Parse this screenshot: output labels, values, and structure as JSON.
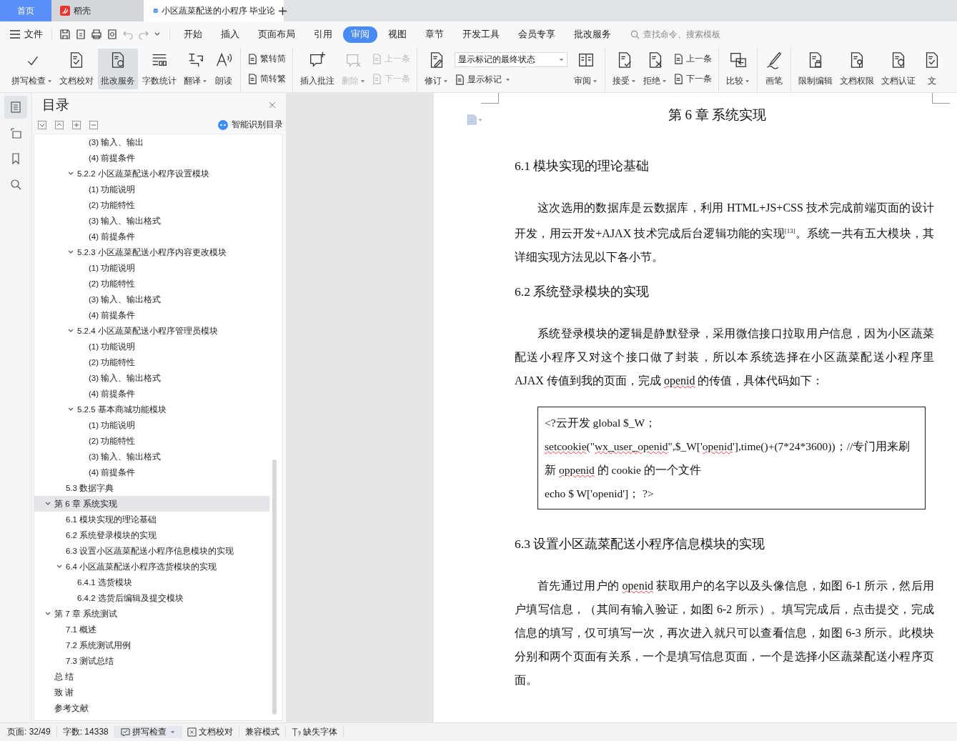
{
  "title_tabs": [
    {
      "label": "首页",
      "kind": "home",
      "selected": false
    },
    {
      "label": "稻壳",
      "kind": "store",
      "selected": false
    },
    {
      "label": "小区蔬菜配送的小程序 毕业论",
      "kind": "document",
      "selected": true
    }
  ],
  "menu": {
    "file": "文件",
    "tabs": [
      {
        "label": "开始",
        "selected": false
      },
      {
        "label": "插入",
        "selected": false
      },
      {
        "label": "页面布局",
        "selected": false
      },
      {
        "label": "引用",
        "selected": false
      },
      {
        "label": "审阅",
        "selected": true
      },
      {
        "label": "视图",
        "selected": false
      },
      {
        "label": "章节",
        "selected": false
      },
      {
        "label": "开发工具",
        "selected": false
      },
      {
        "label": "会员专享",
        "selected": false
      },
      {
        "label": "批改服务",
        "selected": false
      }
    ],
    "search": {
      "placeholder": "查找命令、搜索模板"
    }
  },
  "ribbon": [
    {
      "items": [
        {
          "kind": "big",
          "label": "拼写检查",
          "caret": true,
          "disabled": false,
          "pressed": false
        },
        {
          "kind": "big",
          "label": "文档校对",
          "caret": false,
          "disabled": false,
          "pressed": false
        },
        {
          "kind": "big",
          "label": "批改服务",
          "caret": false,
          "disabled": false,
          "pressed": true
        },
        {
          "kind": "big",
          "label": "字数统计",
          "caret": false,
          "disabled": false,
          "pressed": false
        },
        {
          "kind": "big",
          "label": "翻译",
          "caret": true,
          "disabled": false,
          "pressed": false
        },
        {
          "kind": "big",
          "label": "朗读",
          "caret": false,
          "disabled": false,
          "pressed": false
        }
      ]
    },
    {
      "items": [
        {
          "kind": "pair",
          "items": [
            {
              "kind": "small",
              "label": "繁转简",
              "caret": false,
              "disabled": false
            },
            {
              "kind": "small",
              "label": "简转繁",
              "caret": false,
              "disabled": false
            }
          ]
        }
      ]
    },
    {
      "items": [
        {
          "kind": "big",
          "label": "插入批注",
          "caret": false,
          "disabled": false,
          "pressed": false
        },
        {
          "kind": "big",
          "label": "删除",
          "caret": true,
          "disabled": true,
          "pressed": false
        },
        {
          "kind": "pair",
          "items": [
            {
              "kind": "small",
              "label": "上一条",
              "caret": false,
              "disabled": true
            },
            {
              "kind": "small",
              "label": "下一条",
              "caret": false,
              "disabled": true
            }
          ]
        }
      ]
    },
    {
      "items": [
        {
          "kind": "big",
          "label": "修订",
          "caret": true,
          "disabled": false,
          "pressed": false
        },
        {
          "kind": "pair",
          "items": [
            {
              "kind": "select",
              "label": "显示标记的最终状态",
              "caret": true,
              "disabled": false
            },
            {
              "kind": "small",
              "label": "显示标记",
              "caret": true,
              "disabled": false
            }
          ]
        },
        {
          "kind": "big",
          "label": "审阅",
          "caret": true,
          "disabled": false,
          "pressed": false
        }
      ]
    },
    {
      "items": [
        {
          "kind": "big",
          "label": "接受",
          "caret": true,
          "disabled": false,
          "pressed": false
        },
        {
          "kind": "big",
          "label": "拒绝",
          "caret": true,
          "disabled": false,
          "pressed": false
        },
        {
          "kind": "pair",
          "items": [
            {
              "kind": "small",
              "label": "上一条",
              "caret": false,
              "disabled": false
            },
            {
              "kind": "small",
              "label": "下一条",
              "caret": false,
              "disabled": false
            }
          ]
        }
      ]
    },
    {
      "items": [
        {
          "kind": "big",
          "label": "比较",
          "caret": true,
          "disabled": false,
          "pressed": false
        }
      ]
    },
    {
      "items": [
        {
          "kind": "big",
          "label": "画笔",
          "caret": false,
          "disabled": false,
          "pressed": false
        }
      ]
    },
    {
      "items": [
        {
          "kind": "big",
          "label": "限制编辑",
          "caret": false,
          "disabled": false,
          "pressed": false
        },
        {
          "kind": "big",
          "label": "文档权限",
          "caret": false,
          "disabled": false,
          "pressed": false
        },
        {
          "kind": "big",
          "label": "文档认证",
          "caret": false,
          "disabled": false,
          "pressed": false
        },
        {
          "kind": "big",
          "label": "文",
          "caret": false,
          "disabled": false,
          "pressed": false
        }
      ]
    }
  ],
  "side_strip": [
    {
      "selected": true
    },
    {
      "selected": false
    },
    {
      "selected": false
    },
    {
      "selected": false
    }
  ],
  "toc": {
    "title": "目录",
    "smart_button": "智能识别目录",
    "items": [
      {
        "children": [
          {
            "children": [
              {
                "children": [
                  {
                    "label": "(3)  输入、输出"
                  },
                  {
                    "label": "(4)  前提条件"
                  }
                ]
              },
              {
                "label": "5.2.2  小区蔬菜配送小程序设置模块",
                "expanded": true,
                "selected": false,
                "children": [
                  {
                    "label": "(1)  功能说明"
                  },
                  {
                    "label": "(2)  功能特性"
                  },
                  {
                    "label": "(3)  输入、输出格式"
                  },
                  {
                    "label": "(4)  前提条件"
                  }
                ]
              },
              {
                "label": "5.2.3  小区蔬菜配送小程序内容更改模块",
                "expanded": true,
                "selected": false,
                "children": [
                  {
                    "label": "(1)  功能说明"
                  },
                  {
                    "label": "(2)  功能特性"
                  },
                  {
                    "label": "(3)  输入、输出格式"
                  },
                  {
                    "label": "(4)  前提条件"
                  }
                ]
              },
              {
                "label": "5.2.4  小区蔬菜配送小程序管理员模块",
                "expanded": true,
                "selected": false,
                "children": [
                  {
                    "label": "(1)  功能说明"
                  },
                  {
                    "label": "(2)  功能特性"
                  },
                  {
                    "label": "(3)  输入、输出格式"
                  },
                  {
                    "label": "(4)  前提条件"
                  }
                ]
              },
              {
                "label": "5.2.5  基本商城功能模块",
                "expanded": true,
                "selected": false,
                "children": [
                  {
                    "label": "(1)  功能说明"
                  },
                  {
                    "label": "(2)  功能特性"
                  },
                  {
                    "label": "(3)  输入、输出格式"
                  },
                  {
                    "label": "(4)  前提条件"
                  }
                ]
              }
            ]
          },
          {
            "label": "5.3  数据字典"
          }
        ]
      },
      {
        "label": "第 6 章  系统实现",
        "expanded": true,
        "selected": true,
        "children": [
          {
            "label": "6.1  模块实现的理论基础"
          },
          {
            "label": "6.2  系统登录模块的实现"
          },
          {
            "label": "6.3  设置小区蔬菜配送小程序信息模块的实现"
          },
          {
            "label": "6.4  小区蔬菜配送小程序选货模块的实现",
            "expanded": true,
            "selected": false,
            "children": [
              {
                "label": "6.4.1  选货模块"
              },
              {
                "label": "6.4.2  选货后编辑及提交模块"
              }
            ]
          }
        ]
      },
      {
        "label": "第 7 章  系统测试",
        "expanded": true,
        "selected": false,
        "children": [
          {
            "label": "7.1  概述"
          },
          {
            "label": "7.2  系统测试用例"
          },
          {
            "label": "7.3  测试总结"
          }
        ]
      },
      {
        "label": "总    结"
      },
      {
        "label": "致    谢"
      },
      {
        "label": "参考文献"
      }
    ]
  },
  "document": [
    {
      "kind": "chapter",
      "segments": [
        {
          "text": "第 6 章  系统实现",
          "spell_error": false
        }
      ]
    },
    {
      "kind": "section",
      "segments": [
        {
          "text": "6.1  模块实现的理论基础",
          "spell_error": false
        }
      ]
    },
    {
      "kind": "paragraph",
      "segments": [
        {
          "text": "这次选用的数据库是云数据库，利用 HTML+JS+CSS 技术完成前端页面的设计开发，用云开发+AJAX 技术完成后台逻辑功能的实现$^{[13]}$。系统一共有五大模块，其详细实现方法见以下各小节。",
          "spell_error": false
        }
      ]
    },
    {
      "kind": "section",
      "segments": [
        {
          "text": "6.2  系统登录模块的实现",
          "spell_error": false
        }
      ]
    },
    {
      "kind": "paragraph",
      "segments": [
        {
          "text": "系统登录模块的逻辑是静默登录，采用微信接口拉取用户信息，因为小区蔬菜配送小程序又对这个接口做了封装，所以本系统选择在小区蔬菜配送小程序里 AJAX 传值到我的页面，完成 ",
          "spell_error": false
        },
        {
          "text": "openid",
          "spell_error": true
        },
        {
          "text": " 的传值，具体代码如下：",
          "spell_error": false
        }
      ]
    },
    {
      "kind": "code",
      "lines": [
        [
          {
            "text": "<?云开发    global $_W；",
            "spell_error": false
          }
        ],
        [
          {
            "text": "setcookie",
            "spell_error": true
          },
          {
            "text": "(\"",
            "spell_error": false
          },
          {
            "text": "wx_user_openid",
            "spell_error": true
          },
          {
            "text": "\",$_W['",
            "spell_error": false
          },
          {
            "text": "openid",
            "spell_error": true
          },
          {
            "text": "'],time()+(7*24*3600))；//专门用来刷",
            "spell_error": false
          }
        ],
        [
          {
            "text": "新 ",
            "spell_error": false
          },
          {
            "text": "oppenid",
            "spell_error": true
          },
          {
            "text": " 的 cookie 的一个文件",
            "spell_error": false
          }
        ],
        [
          {
            "text": "echo $  W['openid']；   ?>",
            "spell_error": false
          }
        ]
      ]
    },
    {
      "kind": "section",
      "segments": [
        {
          "text": "6.3  设置小区蔬菜配送小程序信息模块的实现",
          "spell_error": false
        }
      ]
    },
    {
      "kind": "paragraph",
      "segments": [
        {
          "text": "首先通过用户的 ",
          "spell_error": false
        },
        {
          "text": "openid",
          "spell_error": true
        },
        {
          "text": " 获取用户的名字以及头像信息，如图 6-1 所示，然后用户填写信息，（其间有输入验证，如图 6-2 所示）。填写完成后，点击提交，完成信息的填写，仅可填写一次，再次进入就只可以查看信息，如图 6-3 所示。此模块分别和两个页面有关系，一个是填写信息页面，一个是选择小区蔬菜配送小程序页面。",
          "spell_error": false
        }
      ]
    }
  ],
  "status_bar": [
    {
      "kind": "text",
      "label": "页面: 32/49"
    },
    {
      "kind": "text",
      "label": "字数: 14338"
    },
    {
      "kind": "spell",
      "label": "拼写检查"
    },
    {
      "kind": "proof",
      "label": "文档校对"
    },
    {
      "kind": "text",
      "label": "兼容模式"
    },
    {
      "kind": "font",
      "label": "缺失字体"
    }
  ]
}
